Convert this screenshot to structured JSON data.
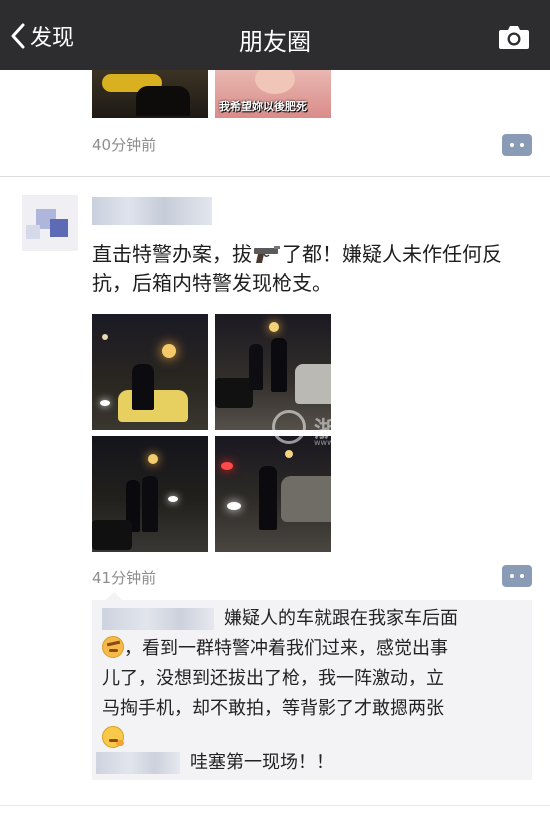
{
  "navbar": {
    "back_label": "发现",
    "title": "朋友圈",
    "camera_icon": "camera-icon"
  },
  "previous_post": {
    "image_caption": "我希望妳以後肥死",
    "time": "40分钟前"
  },
  "post": {
    "text_before_icon": "直击特警办案，拔",
    "text_after_icon": "了都！嫌疑人未作任何反抗，后箱内特警发现枪支。",
    "inline_icon": "pistol-icon",
    "time": "41分钟前",
    "photos": [
      "night-street-photo-1",
      "night-street-photo-2",
      "night-street-photo-3",
      "night-street-photo-4"
    ]
  },
  "watermark": {
    "text": "浙江在线",
    "subtext": "www.zjol.com.cn"
  },
  "comments": [
    {
      "text_line1": "嫌疑人的车就跟在我家车后面",
      "text_line2": "，看到一群特警冲着我们过来，感觉出事",
      "text_line3": "儿了，没想到还拔出了枪，我一阵激动，立",
      "text_line4": "马掏手机，却不敢拍，等背影了才敢摁两张",
      "emoji_start": "angry-face-emoji",
      "emoji_end": "thinking-face-emoji"
    },
    {
      "text": "哇塞第一现场！！"
    }
  ],
  "colors": {
    "navbar_bg": "#2d2d30",
    "comment_button": "#8a9cb5",
    "comment_box_bg": "#f3f3f5",
    "time_text": "#8d8d8d"
  }
}
